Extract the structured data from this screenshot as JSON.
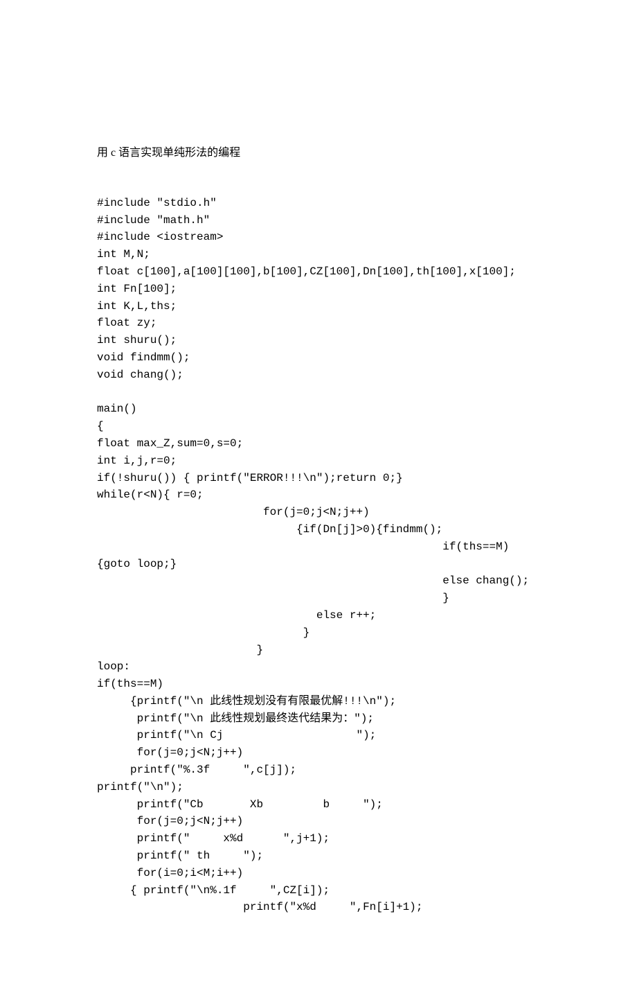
{
  "title": "用 c 语言实现单纯形法的编程",
  "code": "#include \"stdio.h\"\n#include \"math.h\"\n#include <iostream>\nint M,N;\nfloat c[100],a[100][100],b[100],CZ[100],Dn[100],th[100],x[100];\nint Fn[100];\nint K,L,ths;\nfloat zy;\nint shuru();\nvoid findmm();\nvoid chang();\n\nmain()\n{\nfloat max_Z,sum=0,s=0;\nint i,j,r=0;\nif(!shuru()) { printf(\"ERROR!!!\\n\");return 0;}\nwhile(r<N){ r=0;\n                         for(j=0;j<N;j++)\n                              {if(Dn[j]>0){findmm();\n                                                    if(ths==M)\n{goto loop;}\n                                                    else chang();\n                                                    }\n                                 else r++;\n                               }\n                        }\nloop:\nif(ths==M)\n     {printf(\"\\n 此线性规划没有有限最优解!!!\\n\");\n      printf(\"\\n 此线性规划最终迭代结果为：\");\n      printf(\"\\n Cj                    \");\n      for(j=0;j<N;j++)\n     printf(\"%.3f     \",c[j]);\nprintf(\"\\n\");\n      printf(\"Cb       Xb         b     \");\n      for(j=0;j<N;j++)\n      printf(\"     x%d      \",j+1);\n      printf(\" th     \");\n      for(i=0;i<M;i++)\n     { printf(\"\\n%.1f     \",CZ[i]);\n                      printf(\"x%d     \",Fn[i]+1);"
}
